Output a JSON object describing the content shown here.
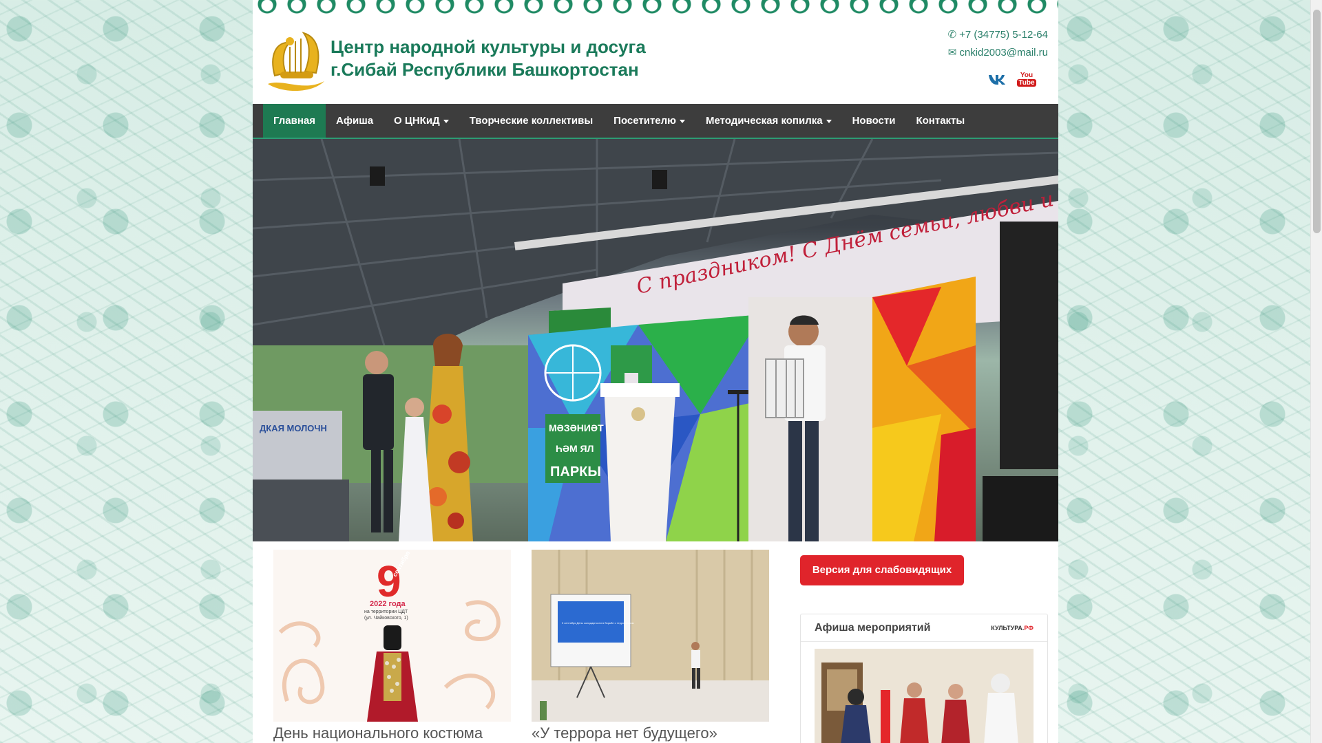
{
  "site": {
    "title_line1": "Центр народной культуры и досуга",
    "title_line2": "г.Сибай Республики Башкортостан"
  },
  "contacts": {
    "phone": "+7 (34775) 5-12-64",
    "email": "cnkid2003@mail.ru",
    "phone_icon": "phone-icon",
    "email_icon": "envelope-icon"
  },
  "social": {
    "vk_label": "ВК",
    "youtube_label_top": "You",
    "youtube_label_bottom": "Tube"
  },
  "nav": {
    "items": [
      {
        "label": "Главная",
        "active": true,
        "dropdown": false
      },
      {
        "label": "Афиша",
        "active": false,
        "dropdown": false
      },
      {
        "label": "О ЦНКиД",
        "active": false,
        "dropdown": true
      },
      {
        "label": "Творческие коллективы",
        "active": false,
        "dropdown": false
      },
      {
        "label": "Посетителю",
        "active": false,
        "dropdown": true
      },
      {
        "label": "Методическая копилка",
        "active": false,
        "dropdown": true
      },
      {
        "label": "Новости",
        "active": false,
        "dropdown": false
      },
      {
        "label": "Контакты",
        "active": false,
        "dropdown": false
      }
    ]
  },
  "hero": {
    "banner_text": "С праздником! С Днём семьи, любви и верности!",
    "sign_line1": "МӘЗӘНИӘТ",
    "sign_line2": "ҺӘМ ЯЛ",
    "sign_line3": "ПАРКЫ",
    "fence_text": "ДКАЯ  МОЛОЧН"
  },
  "news": [
    {
      "title": "День национального костюма",
      "poster_day": "9",
      "poster_month": "сентября",
      "poster_year": "2022 года",
      "poster_place": "на территории ЦДТ",
      "poster_address": "(ул. Чайковского, 1)"
    },
    {
      "title": "«У террора нет будущего»",
      "screen_text": "3 сентября День солидарности в борьбе с терроризмом"
    }
  ],
  "sidebar": {
    "vision_button": "Версия для слабовидящих",
    "afisha_title": "Афиша мероприятий",
    "kultura_main": "КУЛЬТУРА.",
    "kultura_rf": "РФ"
  },
  "colors": {
    "brand_green": "#1a7a5a",
    "nav_bg": "#3d3d3d",
    "nav_active": "#1e7a52",
    "button_red": "#e0242b"
  }
}
